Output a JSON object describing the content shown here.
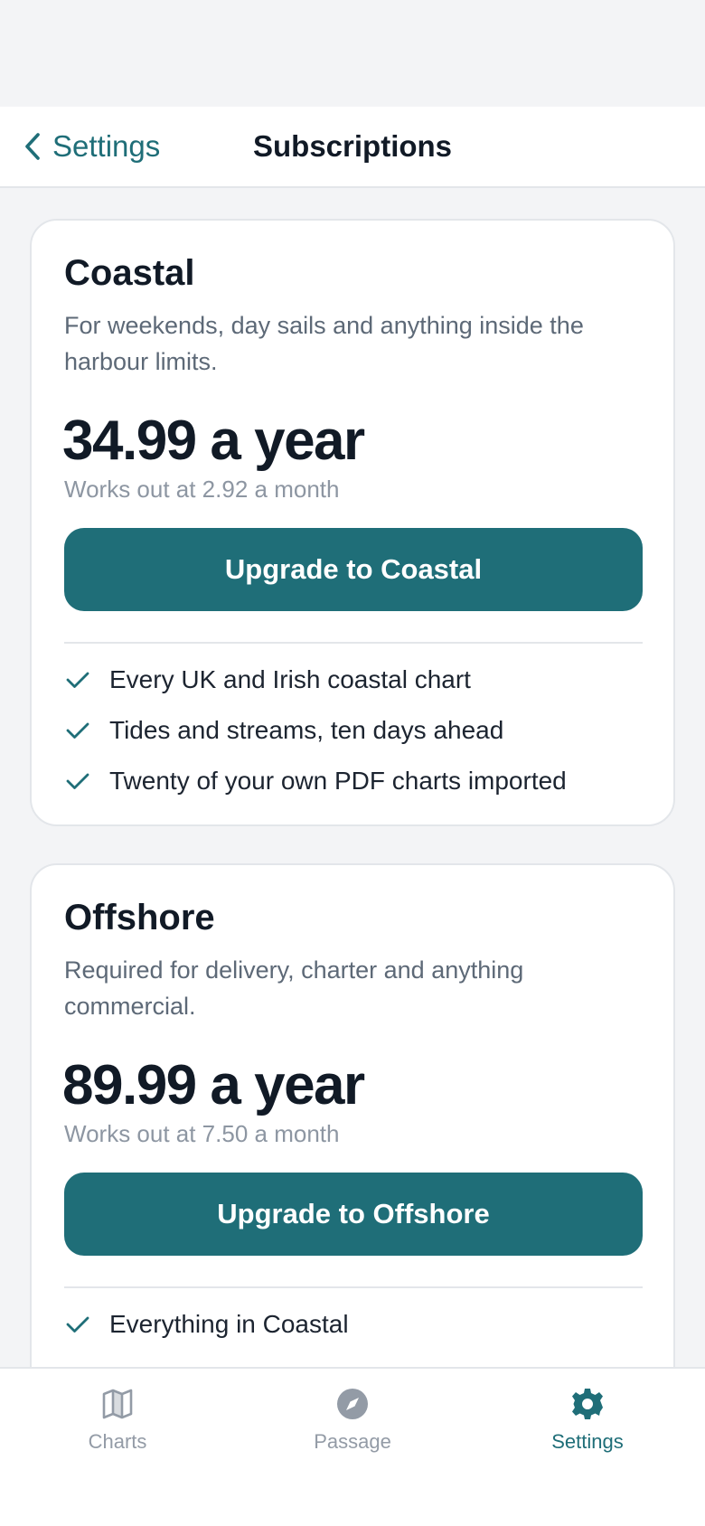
{
  "nav": {
    "back_label": "Settings",
    "title": "Subscriptions"
  },
  "plans": [
    {
      "name": "Coastal",
      "description": "For weekends, day sails and anything inside the harbour limits.",
      "price": "34.99 a year",
      "monthly": "Works out at 2.92 a month",
      "button_label": "Upgrade to Coastal",
      "features": [
        "Every UK and Irish coastal chart",
        "Tides and streams, ten days ahead",
        "Twenty of your own PDF charts imported"
      ]
    },
    {
      "name": "Offshore",
      "description": "Required for delivery, charter and anything commercial.",
      "price": "89.99 a year",
      "monthly": "Works out at 7.50 a month",
      "button_label": "Upgrade to Offshore",
      "features": [
        "Everything in Coastal"
      ]
    }
  ],
  "tabs": [
    {
      "label": "Charts",
      "icon": "map-icon",
      "active": false
    },
    {
      "label": "Passage",
      "icon": "compass-icon",
      "active": false
    },
    {
      "label": "Settings",
      "icon": "gear-icon",
      "active": true
    }
  ],
  "colors": {
    "accent": "#1f6e78",
    "background": "#f3f4f6",
    "card": "#ffffff",
    "inactive_tab": "#939ba6"
  }
}
